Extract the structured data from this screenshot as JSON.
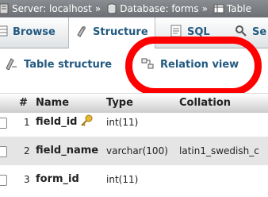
{
  "breadcrumb": {
    "server": "Server: localhost",
    "sep1": "»",
    "database": "Database: forms",
    "sep2": "»",
    "table": "Table"
  },
  "tabs": [
    {
      "label": "Browse"
    },
    {
      "label": "Structure"
    },
    {
      "label": "SQL"
    },
    {
      "label": "Se"
    }
  ],
  "subtabs": [
    {
      "label": "Table structure"
    },
    {
      "label": "Relation view"
    }
  ],
  "table": {
    "headers": {
      "num": "#",
      "name": "Name",
      "type": "Type",
      "collation": "Collation"
    },
    "rows": [
      {
        "num": "1",
        "name": "field_id",
        "type": "int(11)",
        "collation": ""
      },
      {
        "num": "2",
        "name": "field_name",
        "type": "varchar(100)",
        "collation": "latin1_swedish_c"
      },
      {
        "num": "3",
        "name": "form_id",
        "type": "int(11)",
        "collation": ""
      }
    ]
  },
  "colors": {
    "link": "#235a81",
    "highlight": "#ff0000",
    "alt_row": "#e5e5e5"
  }
}
